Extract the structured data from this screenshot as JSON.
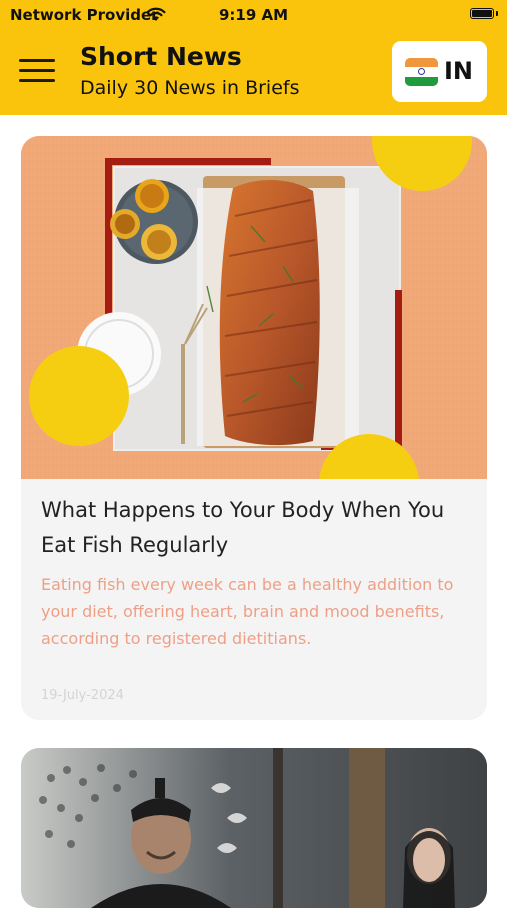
{
  "status_bar": {
    "carrier": "Network Provider",
    "time": "9:19 AM",
    "battery_level": 1.0
  },
  "header": {
    "title": "Short News",
    "subtitle": "Daily 30 News in Briefs",
    "country_code": "IN",
    "menu_icon": "hamburger-menu-icon",
    "flag_icon": "india-flag-icon"
  },
  "colors": {
    "header_bg": "#fbc40c",
    "card_bg": "#f4f4f4",
    "summary_text": "#ee9f86",
    "date_text": "#d4d4d4"
  },
  "articles": [
    {
      "headline": "What Happens to Your Body When You Eat Fish Regularly",
      "summary": "Eating fish every week can be a healthy addition to your diet, offering heart, brain and mood benefits, according to registered dietitians.",
      "date": "19-July-2024",
      "image": "grilled-salmon-fillet-with-lemons-illustration"
    },
    {
      "image": "period-drama-scene-illustration"
    }
  ]
}
